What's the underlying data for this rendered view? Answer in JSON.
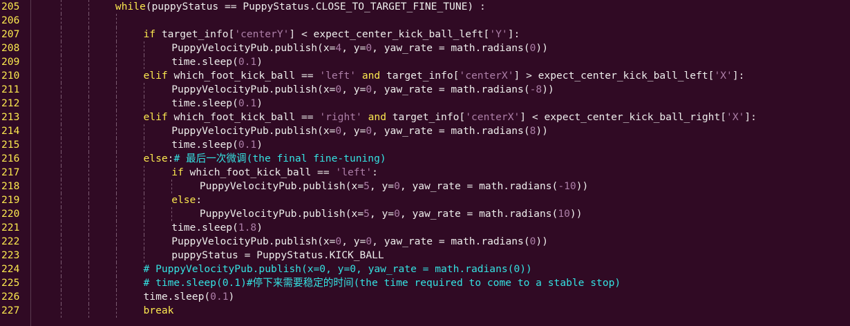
{
  "editor": {
    "theme_colors": {
      "background": "#300a24",
      "line_number": "#fce94f",
      "keyword": "#fce94f",
      "string_number": "#ad7fa8",
      "comment": "#34e2e2",
      "text": "#eeeeec"
    },
    "lines": [
      {
        "num": "205",
        "indent": 4,
        "segments": [
          {
            "t": "kw",
            "v": "while"
          },
          {
            "t": "p",
            "v": "(puppyStatus == PuppyStatus.CLOSE_TO_TARGET_FINE_TUNE) :"
          }
        ]
      },
      {
        "num": "206",
        "indent": 0,
        "segments": []
      },
      {
        "num": "207",
        "indent": 5,
        "segments": [
          {
            "t": "kw",
            "v": "if"
          },
          {
            "t": "p",
            "v": " target_info["
          },
          {
            "t": "str",
            "v": "'centerY'"
          },
          {
            "t": "p",
            "v": "] < expect_center_kick_ball_left["
          },
          {
            "t": "str",
            "v": "'Y'"
          },
          {
            "t": "p",
            "v": "]:"
          }
        ]
      },
      {
        "num": "208",
        "indent": 6,
        "segments": [
          {
            "t": "p",
            "v": "PuppyVelocityPub.publish(x="
          },
          {
            "t": "num",
            "v": "4"
          },
          {
            "t": "p",
            "v": ", y="
          },
          {
            "t": "num",
            "v": "0"
          },
          {
            "t": "p",
            "v": ", yaw_rate = math.radians("
          },
          {
            "t": "num",
            "v": "0"
          },
          {
            "t": "p",
            "v": "))"
          }
        ]
      },
      {
        "num": "209",
        "indent": 6,
        "segments": [
          {
            "t": "p",
            "v": "time.sleep("
          },
          {
            "t": "num",
            "v": "0.1"
          },
          {
            "t": "p",
            "v": ")"
          }
        ]
      },
      {
        "num": "210",
        "indent": 5,
        "segments": [
          {
            "t": "kw",
            "v": "elif"
          },
          {
            "t": "p",
            "v": " which_foot_kick_ball == "
          },
          {
            "t": "str",
            "v": "'left'"
          },
          {
            "t": "p",
            "v": " "
          },
          {
            "t": "kw",
            "v": "and"
          },
          {
            "t": "p",
            "v": " target_info["
          },
          {
            "t": "str",
            "v": "'centerX'"
          },
          {
            "t": "p",
            "v": "] > expect_center_kick_ball_left["
          },
          {
            "t": "str",
            "v": "'X'"
          },
          {
            "t": "p",
            "v": "]:"
          }
        ]
      },
      {
        "num": "211",
        "indent": 6,
        "segments": [
          {
            "t": "p",
            "v": "PuppyVelocityPub.publish(x="
          },
          {
            "t": "num",
            "v": "0"
          },
          {
            "t": "p",
            "v": ", y="
          },
          {
            "t": "num",
            "v": "0"
          },
          {
            "t": "p",
            "v": ", yaw_rate = math.radians("
          },
          {
            "t": "num",
            "v": "-8"
          },
          {
            "t": "p",
            "v": "))"
          }
        ]
      },
      {
        "num": "212",
        "indent": 6,
        "segments": [
          {
            "t": "p",
            "v": "time.sleep("
          },
          {
            "t": "num",
            "v": "0.1"
          },
          {
            "t": "p",
            "v": ")"
          }
        ]
      },
      {
        "num": "213",
        "indent": 5,
        "segments": [
          {
            "t": "kw",
            "v": "elif"
          },
          {
            "t": "p",
            "v": " which_foot_kick_ball == "
          },
          {
            "t": "str",
            "v": "'right'"
          },
          {
            "t": "p",
            "v": " "
          },
          {
            "t": "kw",
            "v": "and"
          },
          {
            "t": "p",
            "v": " target_info["
          },
          {
            "t": "str",
            "v": "'centerX'"
          },
          {
            "t": "p",
            "v": "] < expect_center_kick_ball_right["
          },
          {
            "t": "str",
            "v": "'X'"
          },
          {
            "t": "p",
            "v": "]:"
          }
        ]
      },
      {
        "num": "214",
        "indent": 6,
        "segments": [
          {
            "t": "p",
            "v": "PuppyVelocityPub.publish(x="
          },
          {
            "t": "num",
            "v": "0"
          },
          {
            "t": "p",
            "v": ", y="
          },
          {
            "t": "num",
            "v": "0"
          },
          {
            "t": "p",
            "v": ", yaw_rate = math.radians("
          },
          {
            "t": "num",
            "v": "8"
          },
          {
            "t": "p",
            "v": "))"
          }
        ]
      },
      {
        "num": "215",
        "indent": 6,
        "segments": [
          {
            "t": "p",
            "v": "time.sleep("
          },
          {
            "t": "num",
            "v": "0.1"
          },
          {
            "t": "p",
            "v": ")"
          }
        ]
      },
      {
        "num": "216",
        "indent": 5,
        "segments": [
          {
            "t": "kw",
            "v": "else"
          },
          {
            "t": "p",
            "v": ":"
          },
          {
            "t": "cm",
            "v": "# 最后一次微调(the final fine-tuning)"
          }
        ]
      },
      {
        "num": "217",
        "indent": 6,
        "segments": [
          {
            "t": "kw",
            "v": "if"
          },
          {
            "t": "p",
            "v": " which_foot_kick_ball == "
          },
          {
            "t": "str",
            "v": "'left'"
          },
          {
            "t": "p",
            "v": ":"
          }
        ]
      },
      {
        "num": "218",
        "indent": 7,
        "segments": [
          {
            "t": "p",
            "v": "PuppyVelocityPub.publish(x="
          },
          {
            "t": "num",
            "v": "5"
          },
          {
            "t": "p",
            "v": ", y="
          },
          {
            "t": "num",
            "v": "0"
          },
          {
            "t": "p",
            "v": ", yaw_rate = math.radians("
          },
          {
            "t": "num",
            "v": "-10"
          },
          {
            "t": "p",
            "v": "))"
          }
        ]
      },
      {
        "num": "219",
        "indent": 6,
        "segments": [
          {
            "t": "kw",
            "v": "else"
          },
          {
            "t": "p",
            "v": ":"
          }
        ]
      },
      {
        "num": "220",
        "indent": 7,
        "segments": [
          {
            "t": "p",
            "v": "PuppyVelocityPub.publish(x="
          },
          {
            "t": "num",
            "v": "5"
          },
          {
            "t": "p",
            "v": ", y="
          },
          {
            "t": "num",
            "v": "0"
          },
          {
            "t": "p",
            "v": ", yaw_rate = math.radians("
          },
          {
            "t": "num",
            "v": "10"
          },
          {
            "t": "p",
            "v": "))"
          }
        ]
      },
      {
        "num": "221",
        "indent": 6,
        "segments": [
          {
            "t": "p",
            "v": "time.sleep("
          },
          {
            "t": "num",
            "v": "1.8"
          },
          {
            "t": "p",
            "v": ")"
          }
        ]
      },
      {
        "num": "222",
        "indent": 6,
        "segments": [
          {
            "t": "p",
            "v": "PuppyVelocityPub.publish(x="
          },
          {
            "t": "num",
            "v": "0"
          },
          {
            "t": "p",
            "v": ", y="
          },
          {
            "t": "num",
            "v": "0"
          },
          {
            "t": "p",
            "v": ", yaw_rate = math.radians("
          },
          {
            "t": "num",
            "v": "0"
          },
          {
            "t": "p",
            "v": "))"
          }
        ]
      },
      {
        "num": "223",
        "indent": 6,
        "segments": [
          {
            "t": "p",
            "v": "puppyStatus = PuppyStatus.KICK_BALL"
          }
        ]
      },
      {
        "num": "224",
        "indent": 5,
        "segments": [
          {
            "t": "cm",
            "v": "# PuppyVelocityPub.publish(x=0, y=0, yaw_rate = math.radians(0))"
          }
        ]
      },
      {
        "num": "225",
        "indent": 5,
        "segments": [
          {
            "t": "cm",
            "v": "# time.sleep(0.1)#停下来需要稳定的时间(the time required to come to a stable stop)"
          }
        ]
      },
      {
        "num": "226",
        "indent": 5,
        "segments": [
          {
            "t": "p",
            "v": "time.sleep("
          },
          {
            "t": "num",
            "v": "0.1"
          },
          {
            "t": "p",
            "v": ")"
          }
        ]
      },
      {
        "num": "227",
        "indent": 5,
        "segments": [
          {
            "t": "kw",
            "v": "break"
          }
        ]
      }
    ]
  }
}
